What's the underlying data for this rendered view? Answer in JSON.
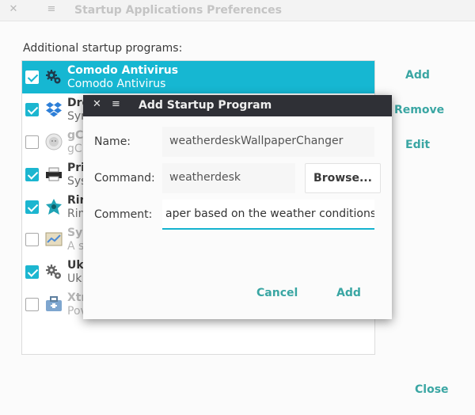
{
  "window": {
    "title": "Startup Applications Preferences",
    "close_glyph": "✕",
    "menu_glyph": "≡",
    "section_label": "Additional startup programs:"
  },
  "programs": [
    {
      "name": "Comodo Antivirus",
      "desc": "Comodo Antivirus",
      "checked": true,
      "selected": true,
      "icon": "gears-icon"
    },
    {
      "name": "Dro",
      "desc": "Syn",
      "checked": true,
      "selected": false,
      "icon": "dropbox-icon"
    },
    {
      "name": "gC",
      "desc": "gC",
      "checked": false,
      "selected": false,
      "disabled": true,
      "icon": "gcolor-icon"
    },
    {
      "name": "Pri",
      "desc": "Sys",
      "checked": true,
      "selected": false,
      "icon": "printer-icon"
    },
    {
      "name": "Rin",
      "desc": "Rin",
      "checked": true,
      "selected": false,
      "icon": "ring-icon"
    },
    {
      "name": "Sys",
      "desc": "A s",
      "checked": false,
      "selected": false,
      "disabled": true,
      "icon": "system-icon"
    },
    {
      "name": "Uk",
      "desc": "Uk",
      "checked": true,
      "selected": false,
      "icon": "gears-icon"
    },
    {
      "name": "Xtr",
      "desc": "Pov",
      "checked": false,
      "selected": false,
      "disabled": true,
      "icon": "toolbox-icon"
    }
  ],
  "side_buttons": {
    "add": "Add",
    "remove": "Remove",
    "edit": "Edit",
    "close": "Close"
  },
  "dialog": {
    "title": "Add Startup Program",
    "close_glyph": "✕",
    "menu_glyph": "≡",
    "name_label": "Name:",
    "name_value": "weatherdeskWallpaperChanger",
    "command_label": "Command:",
    "command_value": "weatherdesk",
    "browse_label": "Browse...",
    "comment_label": "Comment:",
    "comment_value": "aper based on the weather conditions!",
    "cancel_label": "Cancel",
    "add_label": "Add"
  },
  "colors": {
    "accent": "#16b7d2",
    "button_text": "#3aa6a3",
    "dialog_titlebar": "#2f3036"
  }
}
